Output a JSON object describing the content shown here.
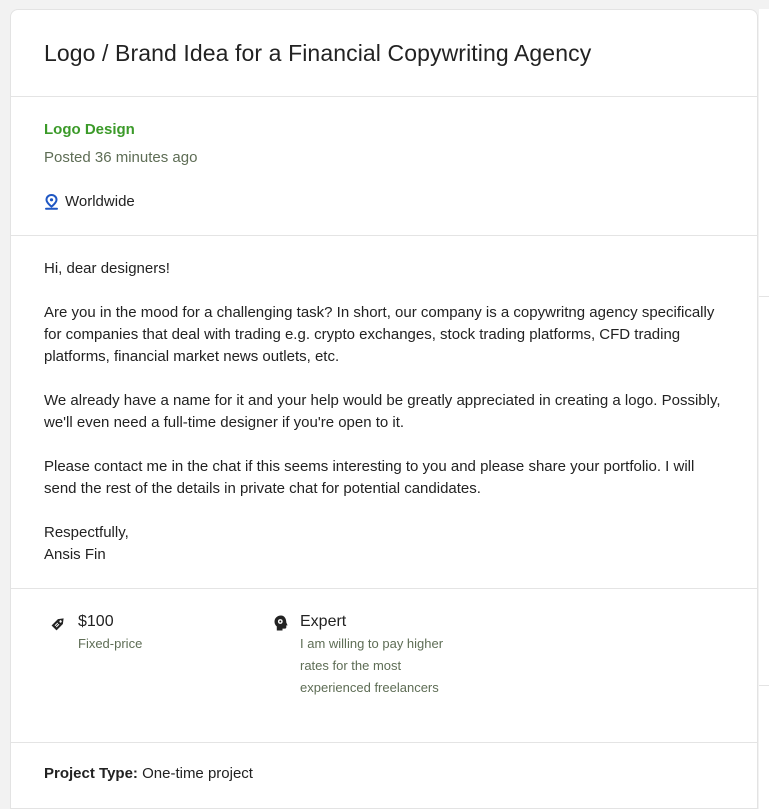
{
  "job": {
    "title": "Logo / Brand Idea for a Financial Copywriting Agency",
    "category": "Logo Design",
    "posted": "Posted 36 minutes ago",
    "location": "Worldwide",
    "description": [
      "Hi, dear designers!",
      "Are you in the mood for a challenging task? In short, our company is a copywritng agency specifically for companies that deal with trading e.g. crypto exchanges, stock trading platforms, CFD trading platforms, financial market news outlets, etc.",
      "We already have a name for it and your help would be greatly appreciated in creating a logo. Possibly, we'll even need a full-time designer if you're open to it.",
      "Please contact me in the chat if this seems interesting to you and please share your portfolio. I will send the rest of the details in private chat for potential candidates."
    ],
    "signature": {
      "line1": "Respectfully,",
      "line2": "Ansis Fin"
    }
  },
  "features": {
    "price": {
      "value": "$100",
      "label": "Fixed-price",
      "icon": "price-tag-icon"
    },
    "level": {
      "value": "Expert",
      "label": "I am willing to pay higher rates for the most experienced freelancers",
      "icon": "expert-head-icon"
    }
  },
  "project": {
    "type_label": "Project Type:",
    "type_value": "One-time project"
  },
  "colors": {
    "accent_green": "#3b9a29",
    "muted_text": "#5e6d55",
    "location_pin": "#1f57c3"
  }
}
